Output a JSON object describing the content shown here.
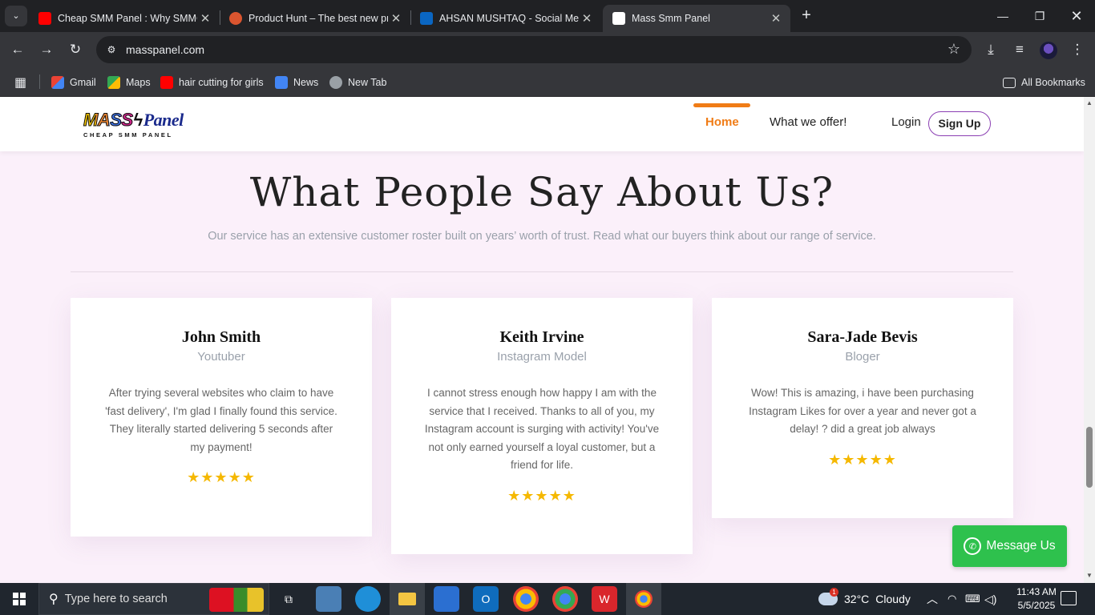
{
  "browser": {
    "tabs": [
      {
        "title": "Cheap SMM Panel : Why SMMC",
        "favicon_color": "#ff0000"
      },
      {
        "title": "Product Hunt – The best new pr",
        "favicon_color": "#da552f"
      },
      {
        "title": "AHSAN MUSHTAQ - Social Medi",
        "favicon_color": "#0a66c2"
      },
      {
        "title": "Mass Smm Panel",
        "favicon_color": "#ffffff"
      }
    ],
    "url": "masspanel.com",
    "bookmarks": [
      {
        "label": "Gmail"
      },
      {
        "label": "Maps"
      },
      {
        "label": "hair cutting for girls"
      },
      {
        "label": "News"
      },
      {
        "label": "New Tab"
      }
    ],
    "all_bookmarks": "All Bookmarks"
  },
  "site": {
    "logo": {
      "word1": "MASS",
      "word2": "Panel",
      "tagline": "CHEAP SMM PANEL"
    },
    "nav": {
      "home": "Home",
      "offer": "What we offer!",
      "login": "Login",
      "signup": "Sign Up"
    },
    "accent_color": "#f07c16",
    "testimonials": {
      "title": "What People Say About Us?",
      "subtitle": "Our service has an extensive customer roster built on years’ worth of trust. Read what our buyers think about our range of service.",
      "cards": [
        {
          "name": "John Smith",
          "role": "Youtuber",
          "text": "After trying several websites who claim to have 'fast delivery', I'm glad I finally found this service. They literally started delivering 5 seconds after my payment!",
          "stars": "★★★★★",
          "rating": 5
        },
        {
          "name": "Keith Irvine",
          "role": "Instagram Model",
          "text": "I cannot stress enough how happy I am with the service that I received. Thanks to all of you, my Instagram account is surging with activity! You've not only earned yourself a loyal customer, but a friend for life.",
          "stars": "★★★★★",
          "rating": 5
        },
        {
          "name": "Sara-Jade Bevis",
          "role": "Bloger",
          "text": "Wow! This is amazing, i have been purchasing Instagram Likes for over a year and never got a delay! ? did a great job always",
          "stars": "★★★★★",
          "rating": 5
        }
      ]
    },
    "message_button": "Message Us"
  },
  "taskbar": {
    "search_placeholder": "Type here to search",
    "weather": {
      "temp": "32°C",
      "condition": "Cloudy",
      "badge": "1"
    },
    "time": "11:43 AM",
    "date": "5/5/2025"
  }
}
